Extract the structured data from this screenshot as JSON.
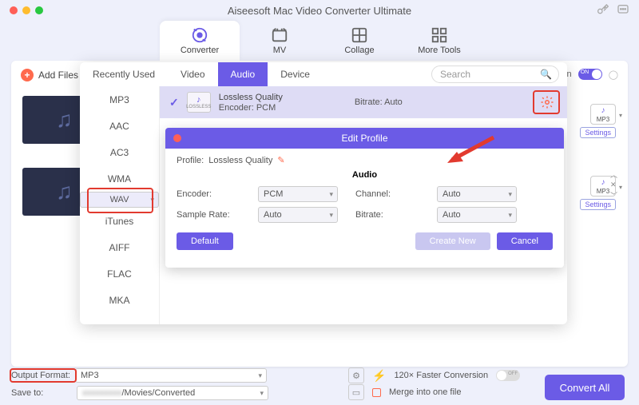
{
  "title": "Aiseesoft Mac Video Converter Ultimate",
  "mainTabs": {
    "converter": "Converter",
    "mv": "MV",
    "collage": "Collage",
    "more": "More Tools"
  },
  "addFiles": "Add Files",
  "topRight": {
    "label": "tion",
    "toggleText": "ON"
  },
  "overlay": {
    "tabs": {
      "recent": "Recently Used",
      "video": "Video",
      "audio": "Audio",
      "device": "Device"
    },
    "searchPlaceholder": "Search",
    "formats": [
      "MP3",
      "AAC",
      "AC3",
      "WMA",
      "WAV",
      "iTunes",
      "AIFF",
      "FLAC",
      "MKA"
    ],
    "quality": {
      "name": "Lossless Quality",
      "encoderLabel": "Encoder:",
      "encoderVal": "PCM",
      "bitrateLabel": "Bitrate:",
      "bitrateVal": "Auto",
      "iconText": "LOSSLESS"
    }
  },
  "editProfile": {
    "title": "Edit Profile",
    "profileLabel": "Profile:",
    "profileVal": "Lossless Quality",
    "audioHeader": "Audio",
    "encoderLabel": "Encoder:",
    "encoderVal": "PCM",
    "channelLabel": "Channel:",
    "channelVal": "Auto",
    "sampleLabel": "Sample Rate:",
    "sampleVal": "Auto",
    "bitrateLabel": "Bitrate:",
    "bitrateVal": "Auto",
    "defaultBtn": "Default",
    "createBtn": "Create New",
    "cancelBtn": "Cancel"
  },
  "rightCard": {
    "fmt": "MP3",
    "settings": "Settings"
  },
  "bottom": {
    "outputFormat": "Output Format:",
    "outputFormatVal": "MP3",
    "saveTo": "Save to:",
    "saveToPath": "/Movies/Converted",
    "saveToBlur": "xxxxxxxxx",
    "faster": "120× Faster Conversion",
    "offText": "OFF",
    "merge": "Merge into one file",
    "convertAll": "Convert All"
  }
}
